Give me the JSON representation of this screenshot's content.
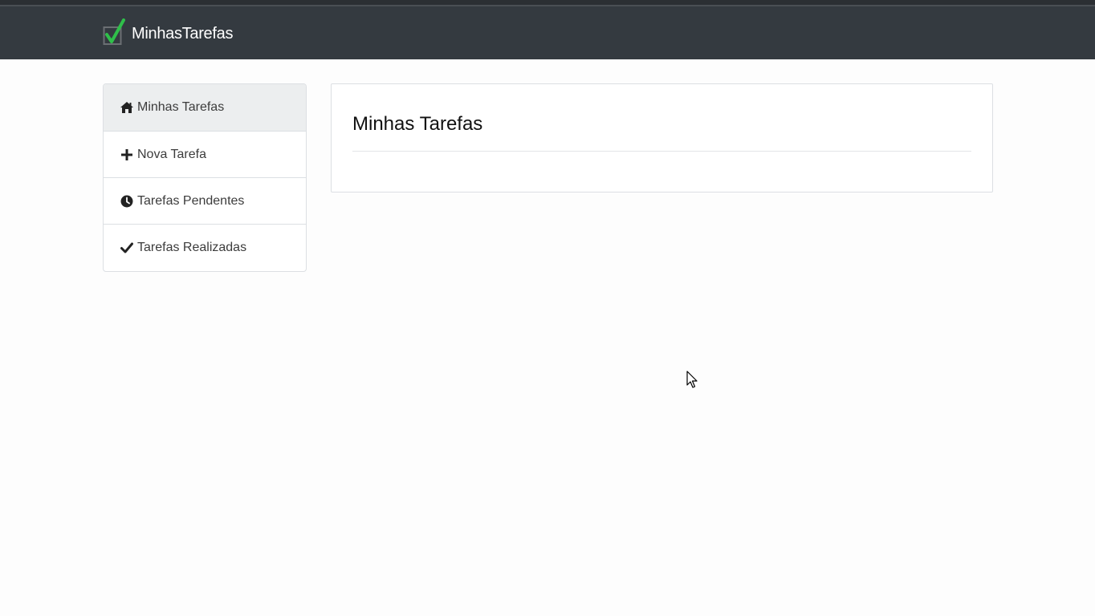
{
  "navbar": {
    "brand_text": "MinhasTarefas",
    "brand_icon": "checkbox-check-icon",
    "background": "#343a40",
    "brand_check_color": "#2fbf4a"
  },
  "sidebar": {
    "items": [
      {
        "label": "Minhas Tarefas",
        "icon": "home-icon",
        "active": true
      },
      {
        "label": "Nova Tarefa",
        "icon": "plus-icon",
        "active": false
      },
      {
        "label": "Tarefas Pendentes",
        "icon": "clock-icon",
        "active": false
      },
      {
        "label": "Tarefas Realizadas",
        "icon": "check-icon",
        "active": false
      }
    ]
  },
  "main": {
    "title": "Minhas Tarefas"
  }
}
